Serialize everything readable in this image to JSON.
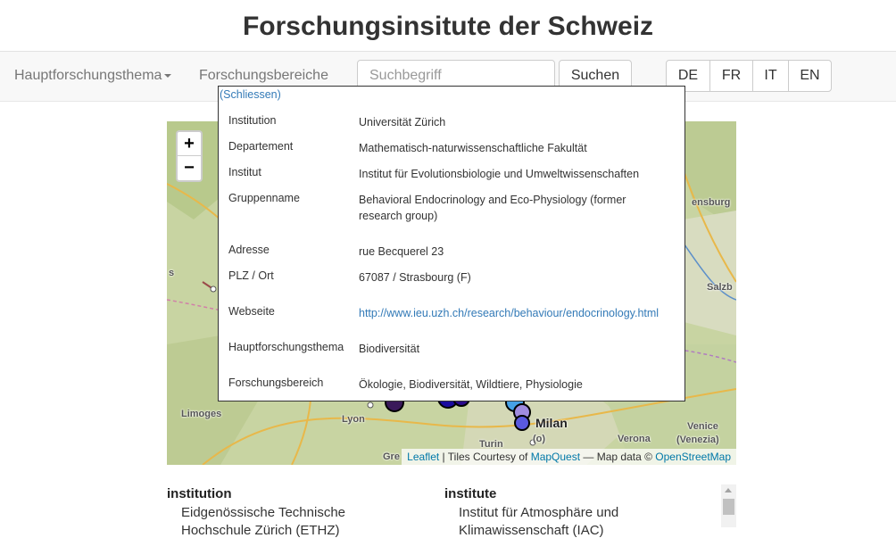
{
  "page": {
    "title": "Forschungsinsitute der Schweiz"
  },
  "nav": {
    "main_topic_label": "Hauptforschungsthema",
    "research_areas_label": "Forschungsbereiche",
    "search_placeholder": "Suchbegriff",
    "search_button": "Suchen",
    "languages": [
      "DE",
      "FR",
      "IT",
      "EN"
    ]
  },
  "map": {
    "zoom_in": "+",
    "zoom_out": "−",
    "labels": {
      "nsburg": "ensburg",
      "salzb": "Salzb",
      "s": "s",
      "limoges": "Limoges",
      "lyon": "Lyon",
      "milan": "Milan",
      "verona": "Verona",
      "venice": "Venice",
      "venezia": "(Venezia)",
      "turin": "Turin",
      "gre": "Gre",
      "o": "(o)"
    },
    "attribution": {
      "leaflet": "Leaflet",
      "sep1": " | Tiles Courtesy of ",
      "mapquest": "MapQuest",
      "sep2": " — Map data © ",
      "osm": "OpenStreetMap"
    },
    "colors": {
      "marker_dark": "#2a0a8c",
      "marker_light": "#a08cdf",
      "marker_cyan": "#46a0e6"
    }
  },
  "popup": {
    "close_label": "(Schliessen)",
    "rows": [
      {
        "key": "Institution",
        "value": "Universität Zürich"
      },
      {
        "key": "Departement",
        "value": "Mathematisch-naturwissenschaftliche Fakultät"
      },
      {
        "key": "Institut",
        "value": "Institut für Evolutionsbiologie und Umweltwissenschaften"
      },
      {
        "key": "Gruppenname",
        "value": "Behavioral Endocrinology and Eco-Physiology (former research group)"
      },
      {
        "key": "Adresse",
        "value": "rue Becquerel 23"
      },
      {
        "key": "PLZ / Ort",
        "value": "67087 / Strasbourg (F)"
      },
      {
        "key": "Webseite",
        "value": "http://www.ieu.uzh.ch/research/behaviour/endocrinology.html"
      },
      {
        "key": "Hauptforschungsthema",
        "value": "Biodiversität"
      },
      {
        "key": "Forschungsbereich",
        "value": "Ökologie, Biodiversität, Wildtiere, Physiologie"
      }
    ]
  },
  "list": {
    "col1_header": "institution",
    "col1_line1": "Eidgenössische Technische",
    "col1_line2": "Hochschule Zürich (ETHZ)",
    "col2_header": "institute",
    "col2_line1": "Institut für Atmosphäre und",
    "col2_line2": "Klimawissenschaft (IAC)"
  }
}
